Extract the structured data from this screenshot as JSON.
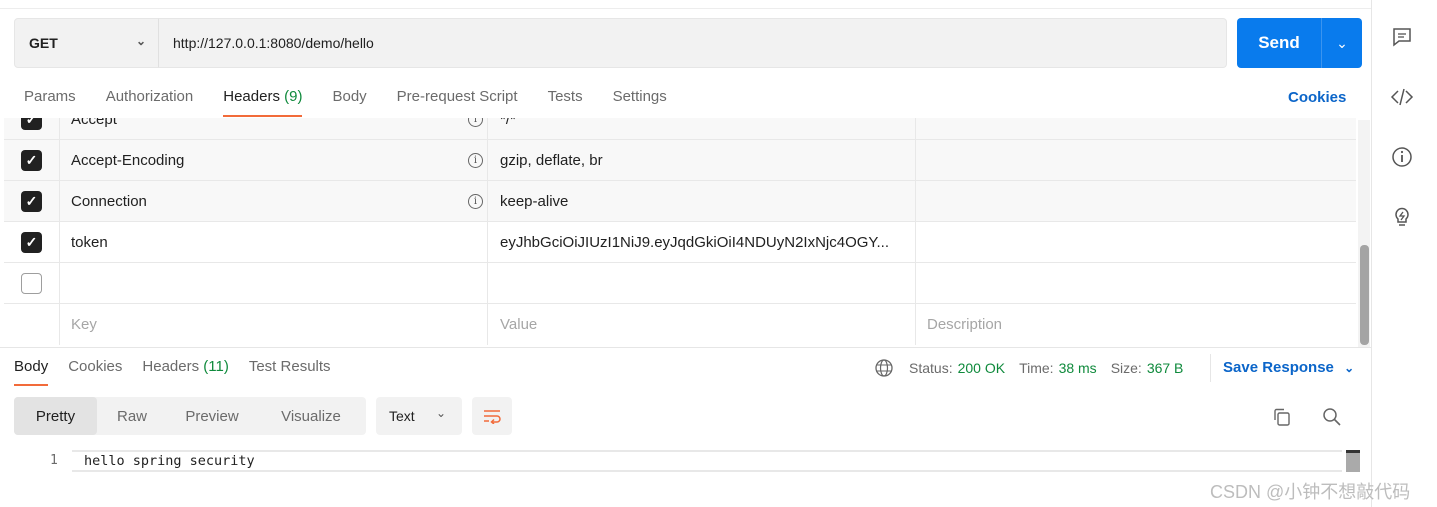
{
  "request": {
    "method": "GET",
    "url": "http://127.0.0.1:8080/demo/hello",
    "send_label": "Send"
  },
  "request_tabs": [
    {
      "label": "Params"
    },
    {
      "label": "Authorization"
    },
    {
      "label": "Headers",
      "count": "(9)",
      "active": true
    },
    {
      "label": "Body"
    },
    {
      "label": "Pre-request Script"
    },
    {
      "label": "Tests"
    },
    {
      "label": "Settings"
    }
  ],
  "cookies_label": "Cookies",
  "headers": [
    {
      "checked": true,
      "key": "Accept",
      "value": "*/*",
      "info": true
    },
    {
      "checked": true,
      "key": "Accept-Encoding",
      "value": "gzip, deflate, br",
      "info": true
    },
    {
      "checked": true,
      "key": "Connection",
      "value": "keep-alive",
      "info": true
    },
    {
      "checked": true,
      "key": "token",
      "value": "eyJhbGciOiJIUzI1NiJ9.eyJqdGkiOiI4NDUyN2IxNjc4OGY...",
      "info": false
    },
    {
      "checked": false,
      "key": "",
      "value": "",
      "info": false
    }
  ],
  "placeholders": {
    "key": "Key",
    "value": "Value",
    "description": "Description"
  },
  "response_tabs": [
    {
      "label": "Body",
      "active": true
    },
    {
      "label": "Cookies"
    },
    {
      "label": "Headers",
      "count": "(11)"
    },
    {
      "label": "Test Results"
    }
  ],
  "status": {
    "status_label": "Status:",
    "status": "200 OK",
    "time_label": "Time:",
    "time": "38 ms",
    "size_label": "Size:",
    "size": "367 B",
    "status_color": "#0f8a3c"
  },
  "save_response": "Save Response",
  "views": [
    "Pretty",
    "Raw",
    "Preview",
    "Visualize"
  ],
  "format": "Text",
  "body": {
    "line": "1",
    "text": "hello spring security"
  },
  "watermark": "CSDN @小钟不想敲代码",
  "accent": "#097bed"
}
